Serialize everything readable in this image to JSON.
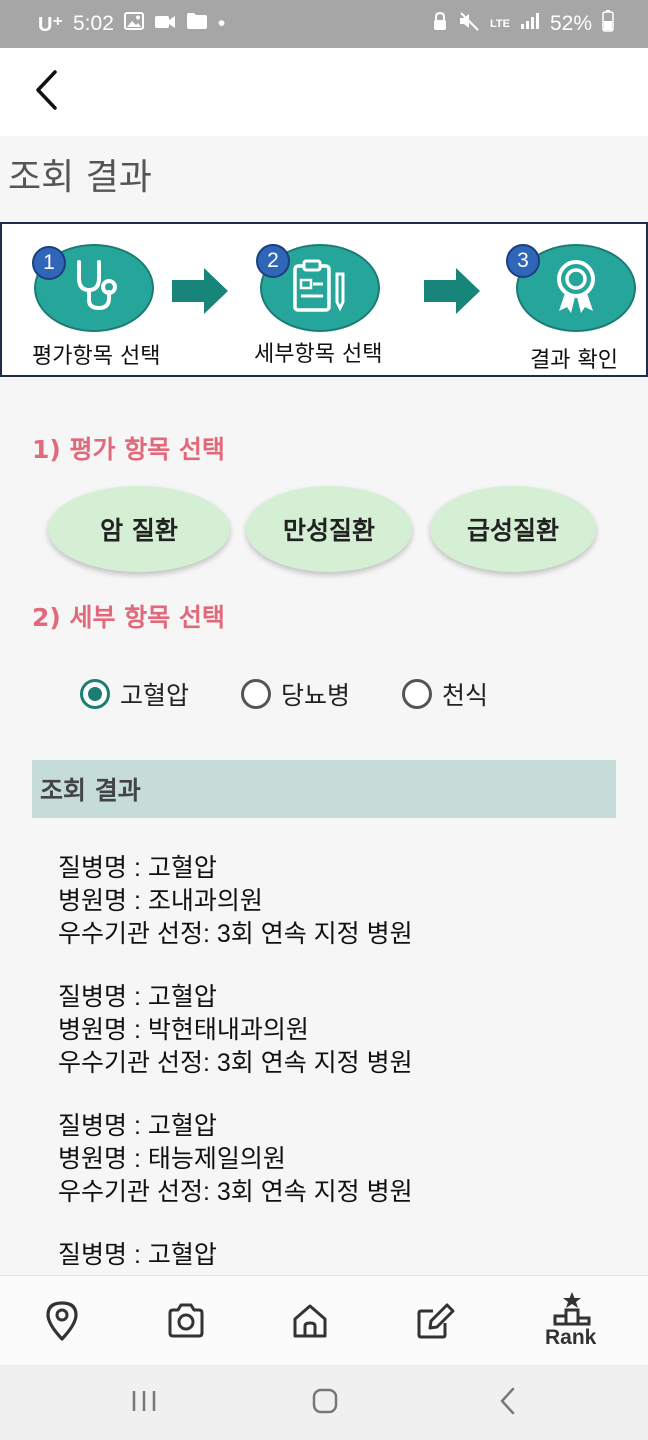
{
  "status_bar": {
    "carrier": "U⁺",
    "time": "5:02",
    "dot": "•",
    "network": "LTE",
    "battery": "52%",
    "icons": [
      "image-icon",
      "video-icon",
      "folder-icon",
      "lock-icon",
      "mute-icon",
      "signal-icon",
      "battery-icon"
    ]
  },
  "appbar": {
    "back_icon": "back-arrow-icon"
  },
  "page_title": "조회 결과",
  "steps": [
    {
      "number": "1",
      "caption": "평가항목 선택",
      "icon": "stethoscope-icon"
    },
    {
      "number": "2",
      "caption": "세부항목 선택",
      "icon": "clipboard-icon"
    },
    {
      "number": "3",
      "caption": "결과 확인",
      "icon": "award-ribbon-icon"
    }
  ],
  "section1": {
    "title": "1) 평가 항목 선택",
    "options": [
      "암 질환",
      "만성질환",
      "급성질환"
    ]
  },
  "section2": {
    "title": "2) 세부 항목 선택",
    "options": [
      "고혈압",
      "당뇨병",
      "천식"
    ],
    "selected": "고혈압"
  },
  "result_header": "조회 결과",
  "results": [
    {
      "disease": "질병명 : 고혈압",
      "hospital": "병원명 : 조내과의원",
      "grade": "우수기관 선정: 3회 연속 지정 병원"
    },
    {
      "disease": "질병명 : 고혈압",
      "hospital": "병원명 : 박현태내과의원",
      "grade": "우수기관 선정: 3회 연속 지정 병원"
    },
    {
      "disease": "질병명 : 고혈압",
      "hospital": "병원명 : 태능제일의원",
      "grade": "우수기관 선정: 3회 연속 지정 병원"
    },
    {
      "disease": "질병명 : 고혈압",
      "hospital": "",
      "grade": ""
    }
  ],
  "bottom_nav": {
    "items": [
      "map-pin-icon",
      "camera-icon",
      "home-icon",
      "edit-icon",
      "rank-icon"
    ],
    "rank_label": "Rank"
  },
  "colors": {
    "accent_teal": "#26a69a",
    "section_title": "#e06a7b",
    "pill_bg": "#d4efd4",
    "result_header_bg": "#c5dcd8",
    "radio_selected": "#1a7f72"
  }
}
